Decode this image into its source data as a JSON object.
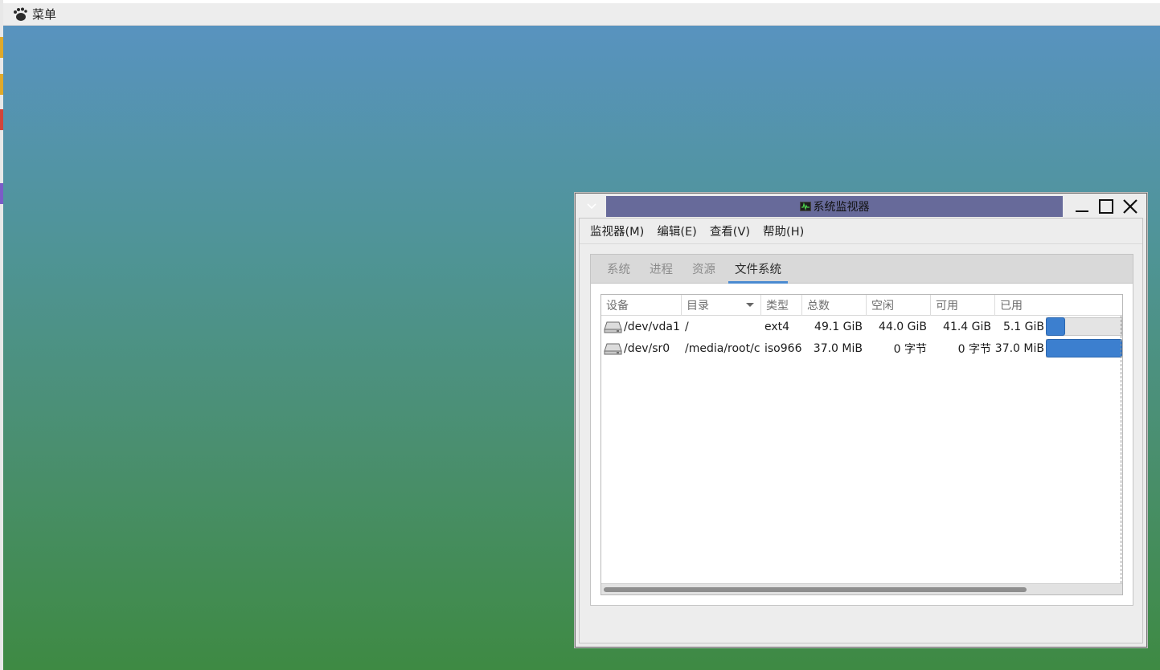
{
  "panel": {
    "menu_label": "菜单",
    "menu_icon": "gnome-foot-icon"
  },
  "window": {
    "title": "系统监视器",
    "title_icon": "system-monitor-icon",
    "title_color": "#676a9a",
    "controls": [
      "minimize-icon",
      "maximize-icon",
      "close-icon"
    ]
  },
  "menubar": [
    {
      "label": "监视器(M)"
    },
    {
      "label": "编辑(E)"
    },
    {
      "label": "查看(V)"
    },
    {
      "label": "帮助(H)"
    }
  ],
  "tabs": [
    {
      "label": "系统",
      "active": false
    },
    {
      "label": "进程",
      "active": false
    },
    {
      "label": "资源",
      "active": false
    },
    {
      "label": "文件系统",
      "active": true
    }
  ],
  "table": {
    "columns": [
      "设备",
      "目录",
      "类型",
      "总数",
      "空闲",
      "可用",
      "已用"
    ],
    "sorted_column": "目录",
    "rows": [
      {
        "device": "/dev/vda1",
        "directory": "/",
        "type": "ext4",
        "total": "49.1 GiB",
        "free": "44.0 GiB",
        "available": "41.4 GiB",
        "used": "5.1 GiB",
        "used_fraction": 0.104
      },
      {
        "device": "/dev/sr0",
        "directory": "/media/root/c",
        "type": "iso966",
        "total": "37.0 MiB",
        "free": "0 字节",
        "available": "0 字节",
        "used": "37.0 MiB",
        "used_fraction": 1.0
      }
    ]
  },
  "colors": {
    "accent": "#4a8ad0",
    "usage_bar": "#3c7fcf"
  }
}
